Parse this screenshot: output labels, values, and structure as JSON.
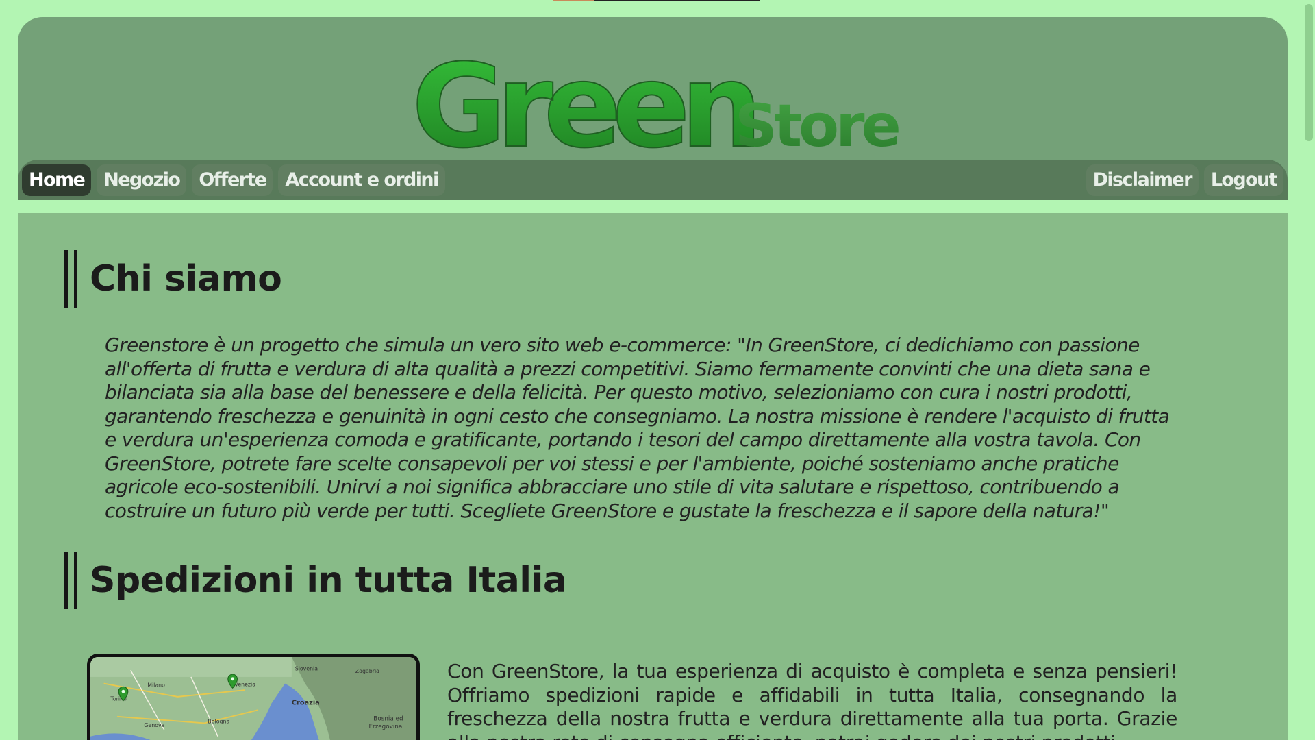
{
  "brand": {
    "logo_main": "Green",
    "logo_suffix": "Store"
  },
  "nav": {
    "left": [
      {
        "label": "Home",
        "active": true
      },
      {
        "label": "Negozio",
        "active": false
      },
      {
        "label": "Offerte",
        "active": false
      },
      {
        "label": "Account e ordini",
        "active": false
      }
    ],
    "right": [
      {
        "label": "Disclaimer"
      },
      {
        "label": "Logout"
      }
    ]
  },
  "sections": {
    "about": {
      "title": "Chi siamo",
      "text": "Greenstore è un progetto che simula un vero sito web e-commerce: \"In GreenStore, ci dedichiamo con passione all'offerta di frutta e verdura di alta qualità a prezzi competitivi. Siamo fermamente convinti che una dieta sana e bilanciata sia alla base del benessere e della felicità. Per questo motivo, selezioniamo con cura i nostri prodotti, garantendo freschezza e genuinità in ogni cesto che consegniamo. La nostra missione è rendere l'acquisto di frutta e verdura un'esperienza comoda e gratificante, portando i tesori del campo direttamente alla vostra tavola. Con GreenStore, potrete fare scelte consapevoli per voi stessi e per l'ambiente, poiché sosteniamo anche pratiche agricole eco-sostenibili. Unirvi a noi significa abbracciare uno stile di vita salutare e rispettoso, contribuendo a costruire un futuro più verde per tutti. Scegliete GreenStore e gustate la freschezza e il sapore della natura!\""
    },
    "shipping": {
      "title": "Spedizioni in tutta Italia",
      "text": "Con GreenStore, la tua esperienza di acquisto è completa e senza pensieri! Offriamo spedizioni rapide e affidabili in tutta Italia, consegnando la freschezza della nostra frutta e verdura direttamente alla tua porta. Grazie alla nostra rete di consegna efficiente, potrai godere dei nostri prodotti",
      "map_labels": [
        "Slovenia",
        "Zagabria",
        "Milano",
        "Venezia",
        "Torino",
        "Croazia",
        "Genova",
        "Bologna",
        "Bosnia ed",
        "Erzegovina"
      ]
    }
  },
  "colors": {
    "page_bg": "#b3f5b3",
    "header_bg": "#74a178",
    "nav_bg": "#587a5a",
    "content_bg": "#88bb88",
    "active_tab": "#2f3c2f"
  }
}
